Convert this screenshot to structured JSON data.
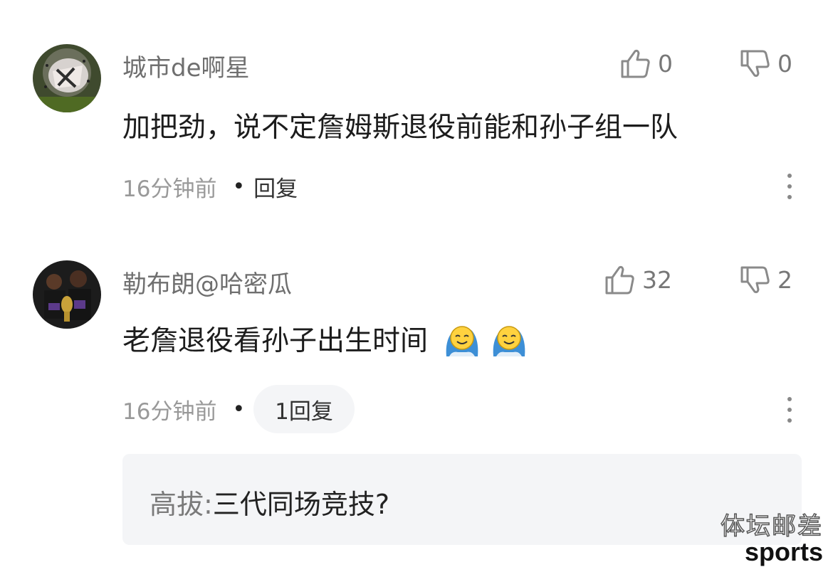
{
  "comments": [
    {
      "username": "城市de啊星",
      "content": "加把劲，说不定詹姆斯退役前能和孙子组一队",
      "time": "16分钟前",
      "reply_label": "回复",
      "likes": "0",
      "dislikes": "0"
    },
    {
      "username": "勒布朗@哈密瓜",
      "content": "老詹退役看孙子出生时间",
      "time": "16分钟前",
      "reply_label": "1回复",
      "likes": "32",
      "dislikes": "2",
      "subreply": {
        "name": "高拔",
        "separator": ":",
        "text": "三代同场竞技?"
      }
    }
  ],
  "watermark": {
    "cn": "体坛邮差",
    "en": "sports"
  },
  "icons": [
    "like-icon",
    "dislike-icon",
    "more-icon",
    "emoji-icon"
  ]
}
